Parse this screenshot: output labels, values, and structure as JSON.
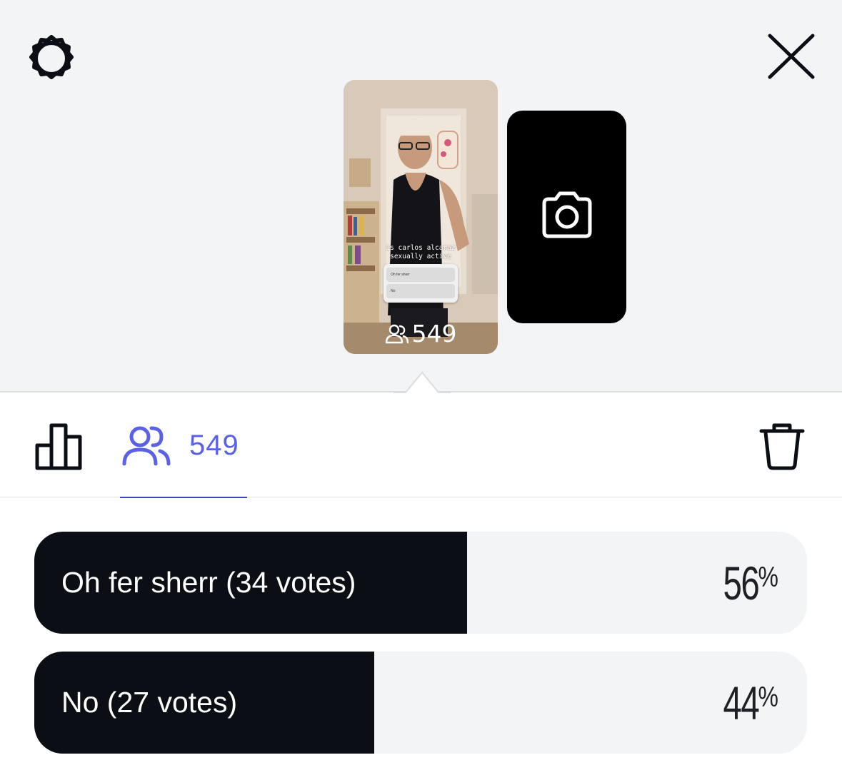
{
  "header": {
    "settings_icon": "gear-icon",
    "close_icon": "close-icon"
  },
  "story": {
    "caption_line1": "is carlos alcaraz",
    "caption_line2": "sexually active",
    "mini_poll_options": [
      "Oh fer sherr",
      "No"
    ],
    "viewer_count": "549"
  },
  "camera_card": {
    "icon": "camera-icon"
  },
  "tabs": {
    "results_icon": "bar-chart-icon",
    "viewers_icon": "people-icon",
    "viewers_count": "549",
    "active_tab": "viewers",
    "delete_icon": "trash-icon"
  },
  "poll": {
    "options": [
      {
        "label": "Oh fer sherr (34 votes)",
        "percent_value": "56",
        "percent_sign": "%",
        "fraction": 0.56
      },
      {
        "label": "No (27 votes)",
        "percent_value": "44",
        "percent_sign": "%",
        "fraction": 0.44
      }
    ]
  },
  "colors": {
    "accent": "#5a61e6",
    "bar_fill": "#0b0f15",
    "background_top": "#f3f4f6",
    "track": "#f3f4f6"
  }
}
